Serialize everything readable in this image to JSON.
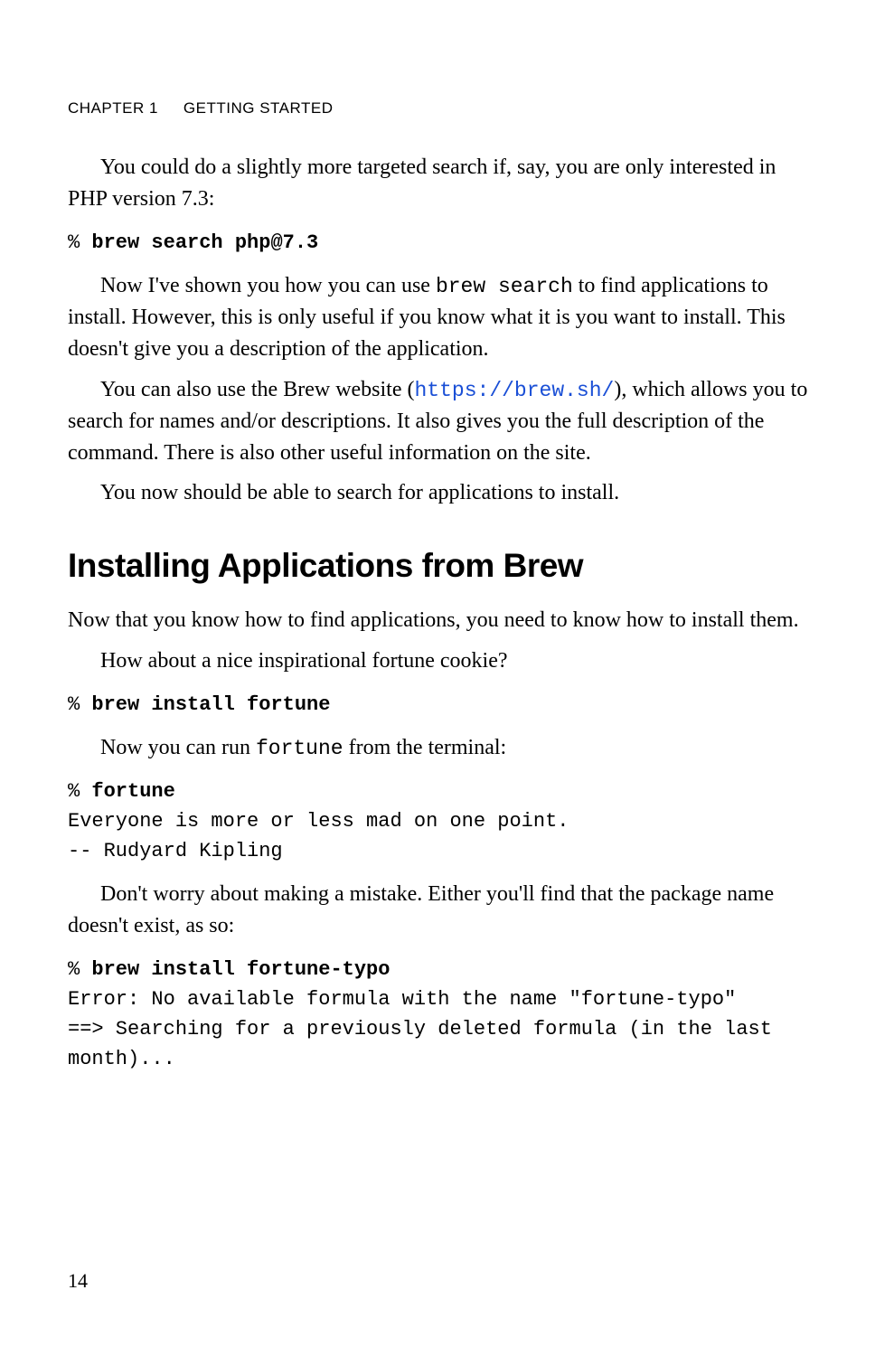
{
  "header": {
    "chapter_label": "Chapter 1",
    "chapter_title": "Getting Started"
  },
  "para1": "You could do a slightly more targeted search if, say, you are only interested in PHP version 7.3:",
  "code1": {
    "prompt": "% ",
    "cmd": "brew search php@7.3"
  },
  "para2a": "Now I've shown you how you can use ",
  "para2_code": "brew search",
  "para2b": " to find applications to install. However, this is only useful if you know what it is you want to install. This doesn't give you a description of the application.",
  "para3a": "You can also use the Brew website (",
  "para3_link": "https://brew.sh/",
  "para3b": "), which allows you to search for names and/or descriptions. It also gives you the full description of the command. There is also other useful information on the site.",
  "para4": "You now should be able to search for applications to install.",
  "section_heading": "Installing Applications from Brew",
  "para5": "Now that you know how to find applications, you need to know how to install them.",
  "para6": "How about a nice inspirational fortune cookie?",
  "code2": {
    "prompt": "% ",
    "cmd": "brew install fortune"
  },
  "para7a": "Now you can run ",
  "para7_code": "fortune",
  "para7b": " from the terminal:",
  "code3": {
    "prompt": "% ",
    "cmd": "fortune",
    "out1": "Everyone is more or less mad on one point.",
    "out2": "-- Rudyard Kipling"
  },
  "para8": "Don't worry about making a mistake. Either you'll find that the package name doesn't exist, as so:",
  "code4": {
    "prompt": "% ",
    "cmd": "brew install fortune-typo",
    "out1": "Error: No available formula with the name \"fortune-typo\"",
    "out2": "==> Searching for a previously deleted formula (in the last month)..."
  },
  "page_number": "14"
}
